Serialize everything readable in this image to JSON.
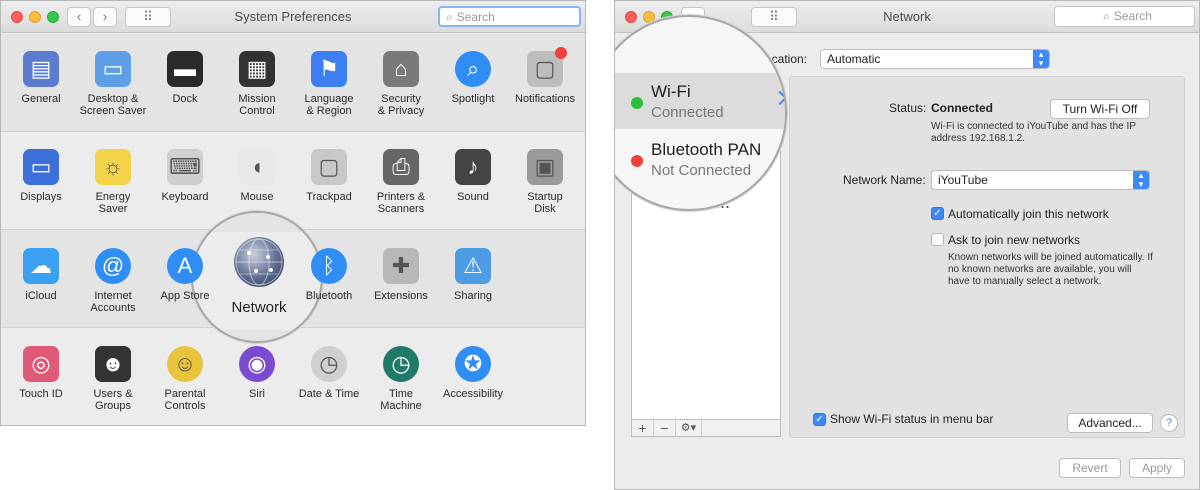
{
  "prefs": {
    "title": "System Preferences",
    "search_placeholder": "Search",
    "rows": [
      [
        {
          "label": "General",
          "icon": "general-icon"
        },
        {
          "label": "Desktop &\nScreen Saver",
          "icon": "desktop-icon"
        },
        {
          "label": "Dock",
          "icon": "dock-icon"
        },
        {
          "label": "Mission\nControl",
          "icon": "mission-control-icon"
        },
        {
          "label": "Language\n& Region",
          "icon": "language-icon"
        },
        {
          "label": "Security\n& Privacy",
          "icon": "security-icon"
        },
        {
          "label": "Spotlight",
          "icon": "spotlight-icon"
        },
        {
          "label": "Notifications",
          "icon": "notifications-icon"
        }
      ],
      [
        {
          "label": "Displays",
          "icon": "displays-icon"
        },
        {
          "label": "Energy\nSaver",
          "icon": "energy-saver-icon"
        },
        {
          "label": "Keyboard",
          "icon": "keyboard-icon"
        },
        {
          "label": "Mouse",
          "icon": "mouse-icon"
        },
        {
          "label": "Trackpad",
          "icon": "trackpad-icon"
        },
        {
          "label": "Printers &\nScanners",
          "icon": "printer-icon"
        },
        {
          "label": "Sound",
          "icon": "sound-icon"
        },
        {
          "label": "Startup\nDisk",
          "icon": "startup-disk-icon"
        }
      ],
      [
        {
          "label": "iCloud",
          "icon": "icloud-icon"
        },
        {
          "label": "Internet\nAccounts",
          "icon": "internet-accounts-icon"
        },
        {
          "label": "App Store",
          "icon": "app-store-icon"
        },
        {
          "label": "",
          "icon": ""
        },
        {
          "label": "Bluetooth",
          "icon": "bluetooth-icon"
        },
        {
          "label": "Extensions",
          "icon": "extensions-icon"
        },
        {
          "label": "Sharing",
          "icon": "sharing-icon"
        }
      ],
      [
        {
          "label": "Touch ID",
          "icon": "touch-id-icon"
        },
        {
          "label": "Users &\nGroups",
          "icon": "users-icon"
        },
        {
          "label": "Parental\nControls",
          "icon": "parental-controls-icon"
        },
        {
          "label": "Siri",
          "icon": "siri-icon"
        },
        {
          "label": "Date & Time",
          "icon": "date-time-icon"
        },
        {
          "label": "Time\nMachine",
          "icon": "time-machine-icon"
        },
        {
          "label": "Accessibility",
          "icon": "accessibility-icon"
        }
      ]
    ],
    "magnified_label": "Network",
    "clipped_left": "App St",
    "clipped_right": "etooth"
  },
  "network": {
    "title": "Network",
    "search_placeholder": "Search",
    "location_label": "ocation:",
    "location_value": "Automatic",
    "services": [
      {
        "name": "Wi-Fi",
        "status": "Connected",
        "dot": "#2dc03c"
      },
      {
        "name": "Bluetooth PAN",
        "status": "Not Connected",
        "dot": "#f0403e"
      }
    ],
    "partial_service": "n 2 10/...",
    "status_label": "Status:",
    "status_value": "Connected",
    "turn_off_button": "Turn Wi-Fi Off",
    "status_detail": "Wi-Fi is connected to iYouTube and has the IP address 192.168.1.2.",
    "network_name_label": "Network Name:",
    "network_name_value": "iYouTube",
    "auto_join_label": "Automatically join this network",
    "ask_join_label": "Ask to join new networks",
    "ask_join_detail": "Known networks will be joined automatically. If no known networks are available, you will have to manually select a network.",
    "show_status_label": "Show Wi-Fi status in menu bar",
    "advanced_button": "Advanced...",
    "help_button": "?",
    "revert_button": "Revert",
    "apply_button": "Apply",
    "add_button": "+",
    "remove_button": "−",
    "gear_button": "⚙▾"
  }
}
